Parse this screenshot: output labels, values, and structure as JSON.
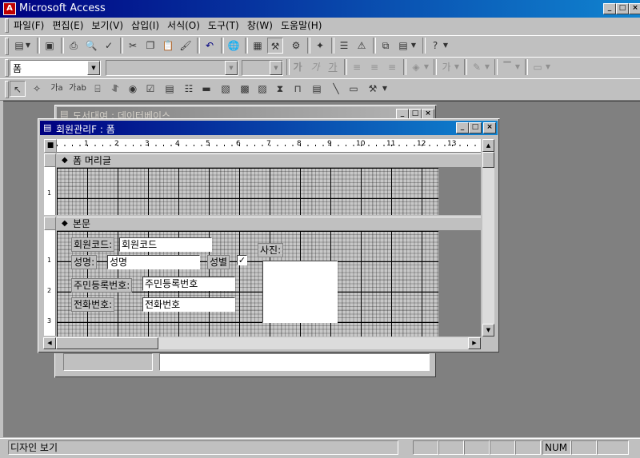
{
  "app": {
    "title": "Microsoft Access"
  },
  "menu": [
    "파일(F)",
    "편집(E)",
    "보기(V)",
    "삽입(I)",
    "서식(O)",
    "도구(T)",
    "창(W)",
    "도움말(H)"
  ],
  "format_toolbar": {
    "object_value": "폼",
    "font_value": "",
    "size_value": ""
  },
  "toolbox": {
    "label_tool": "가a",
    "textbox_tool": "가ab"
  },
  "bg_window": {
    "title": "도서대여 : 데이터베이스"
  },
  "form_window": {
    "title": "회원관리F : 폼"
  },
  "ruler": {
    "ticks": [
      "1",
      "2",
      "3",
      "4",
      "5",
      "6",
      "7",
      "8",
      "9",
      "10",
      "11",
      "12",
      "13"
    ]
  },
  "vruler": {
    "header": [
      "1"
    ],
    "detail": [
      "1",
      "2",
      "3"
    ]
  },
  "sections": {
    "header": "폼 머리글",
    "detail": "본문"
  },
  "controls": {
    "code_label": "회원코드:",
    "code_value": "회원코드",
    "name_label": "성명:",
    "name_value": "성명",
    "gender_label": "성별",
    "gender_checked": true,
    "jumin_label": "주민등록번호:",
    "jumin_value": "주민등록번호",
    "phone_label": "전화번호:",
    "phone_value": "전화번호",
    "photo_label": "사진:"
  },
  "statusbar": {
    "text": "디자인 보기",
    "num": "NUM"
  }
}
